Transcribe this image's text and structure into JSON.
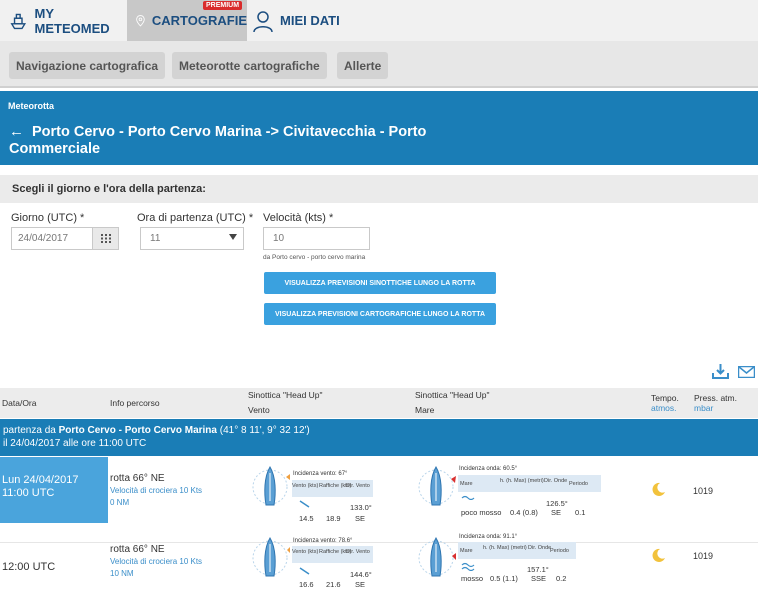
{
  "topnav": {
    "tab1": "MY METEOMED",
    "tab2": "CARTOGRAFIE",
    "tab2_badge": "PREMIUM",
    "tab3": "MIEI DATI"
  },
  "subnav": [
    "Navigazione cartografica",
    "Meteorotte cartografiche",
    "Allerte"
  ],
  "header": {
    "crumb": "Meteorotta",
    "title": "Porto Cervo - Porto Cervo Marina -> Civitavecchia - Porto Commerciale"
  },
  "form": {
    "heading": "Scegli il giorno e l'ora della partenza:",
    "day_label": "Giorno (UTC) *",
    "day_value": "24/04/2017",
    "hour_label": "Ora di partenza (UTC) *",
    "hour_value": "11",
    "speed_label": "Velocità (kts) *",
    "speed_value": "10",
    "note": "da Porto cervo - porto cervo marina",
    "btn_synoptic": "VISUALIZZA PREVISIONI SINOTTICHE LUNGO LA ROTTA",
    "btn_carto": "VISUALIZZA PREVISIONI CARTOGRAFICHE LUNGO LA ROTTA"
  },
  "table": {
    "col_date": "Data/Ora",
    "col_info": "Info percorso",
    "col_wind": "Sinottica \"Head Up\"",
    "col_wind_sub": "Vento",
    "col_sea": "Sinottica \"Head Up\"",
    "col_sea_sub": "Mare",
    "col_weather": "Tempo.",
    "col_weather_sub": "atmos.",
    "col_press": "Press. atm.",
    "col_press_sub": "mbar",
    "departure_prefix": "partenza da ",
    "departure_place": "Porto Cervo - Porto Cervo Marina",
    "departure_coords": " (41° 8 11', 9° 32 12')",
    "departure_time": "il 24/04/2017 alle ore 11:00 UTC",
    "wind_hdr": [
      "Vento (kts)",
      "Raffiche (kts)",
      "Dir. Vento"
    ],
    "sea_hdr": [
      "Mare",
      "h. (h. Max) (metri)",
      "Dir. Onde",
      "Periodo"
    ],
    "rows": [
      {
        "date": "Lun 24/04/2017",
        "time": "11:00 UTC",
        "route": "rotta 66° NE",
        "cruise": "Velocità di crociera 10 Kts",
        "nm": "0 NM",
        "wind_incidence": "Incidenza vento: 67°",
        "wind": "14.5",
        "gust": "18.9",
        "wind_dir_deg": "133.0°",
        "wind_dir": "SE",
        "wave_incidence": "Incidenza onda: 60.5°",
        "sea": "poco mosso",
        "wave_h": "0.4 (0.8)",
        "wave_dir_deg": "126.5°",
        "wave_dir": "SE",
        "period": "0.1",
        "pressure": "1019"
      },
      {
        "date": "",
        "time": "12:00 UTC",
        "route": "rotta 66° NE",
        "cruise": "Velocità di crociera 10 Kts",
        "nm": "10 NM",
        "wind_incidence": "Incidenza vento: 78.6°",
        "wind": "16.6",
        "gust": "21.6",
        "wind_dir_deg": "144.6°",
        "wind_dir": "SE",
        "wave_incidence": "Incidenza onda: 91.1°",
        "sea": "mosso",
        "wave_h": "0.5 (1.1)",
        "wave_dir_deg": "157.1°",
        "wave_dir": "SSE",
        "period": "0.2",
        "pressure": "1019"
      }
    ]
  }
}
